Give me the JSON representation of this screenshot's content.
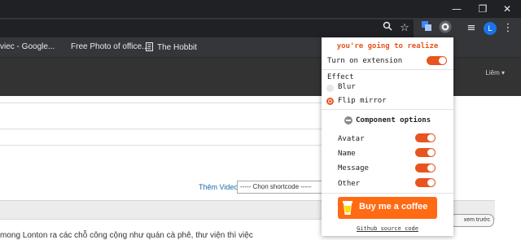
{
  "browser": {
    "bookmarks": [
      {
        "label": "viec - Google..."
      },
      {
        "label": "Free Photo of office..."
      },
      {
        "label": "The Hobbit"
      }
    ],
    "profile_initial": "L"
  },
  "page": {
    "nav_user": "Liêm ▾",
    "them_video": "Thêm Video",
    "shortcode_select": "----- Chọn shortcode -----",
    "prev_button": "xem trước",
    "bottom_text": "mong Lonton ra các chỗ công cộng như quán cà phê, thư viện thì việc"
  },
  "popup": {
    "title": "you're going to realize",
    "turn_on_label": "Turn on extension",
    "turn_on": true,
    "effect_label": "Effect",
    "effects": [
      {
        "label": "Blur",
        "selected": false
      },
      {
        "label": "Flip mirror",
        "selected": true
      }
    ],
    "component_options_label": "Component options",
    "components": [
      {
        "label": "Avatar",
        "on": true
      },
      {
        "label": "Name",
        "on": true
      },
      {
        "label": "Message",
        "on": true
      },
      {
        "label": "Other",
        "on": true
      }
    ],
    "coffee_button": "Buy me a coffee",
    "github_link": "Github source code",
    "accent_color": "#e8541e",
    "coffee_color": "#ff6a13"
  }
}
